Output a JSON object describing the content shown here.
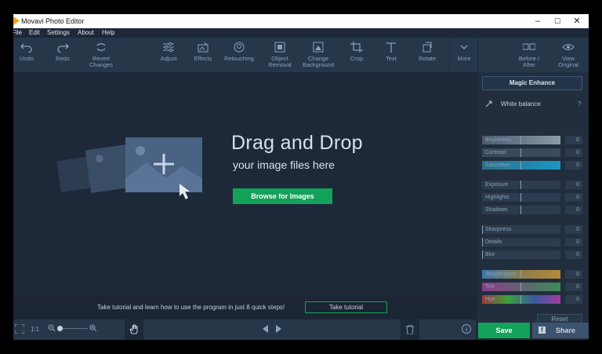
{
  "window": {
    "title": "Movavi Photo Editor",
    "minimize": "–",
    "maximize": "☐",
    "close": "✕"
  },
  "menu": [
    "File",
    "Edit",
    "Settings",
    "About",
    "Help"
  ],
  "toolbar": {
    "undo": "Undo",
    "redo": "Redo",
    "revert": [
      "Revert",
      "Changes"
    ],
    "adjust": "Adjust",
    "effects": "Effects",
    "retouching": "Retouching",
    "object_removal": [
      "Object",
      "Removal"
    ],
    "change_background": [
      "Change",
      "Background"
    ],
    "crop": "Crop",
    "text": "Text",
    "rotate": "Rotate",
    "more": "More",
    "before_after": [
      "Before /",
      "After"
    ],
    "view_original": [
      "View",
      "Original"
    ]
  },
  "canvas": {
    "drop_title": "Drag and Drop",
    "drop_subtitle": "your image files here",
    "browse_button": "Browse for Images"
  },
  "tutorial": {
    "text": "Take tutorial and learn how to use the program in just 8 quick steps!",
    "button": "Take tutorial"
  },
  "statusbar": {
    "zoom_ratio": "1:1"
  },
  "panel": {
    "magic_enhance": "Magic Enhance",
    "white_balance": "White balance",
    "help": "?",
    "sliders": [
      {
        "label": "Brightness",
        "value": "0",
        "fill": 1.0
      },
      {
        "label": "Contrast",
        "value": "0",
        "fill": 0.5
      },
      {
        "label": "Saturation",
        "value": "0",
        "fill": 1.0
      },
      {
        "label": "Exposure",
        "value": "0",
        "fill": 0.5
      },
      {
        "label": "Highlights",
        "value": "0",
        "fill": 0.5
      },
      {
        "label": "Shadows",
        "value": "0",
        "fill": 0.5
      },
      {
        "label": "Sharpness",
        "value": "0",
        "fill": 0.0
      },
      {
        "label": "Details",
        "value": "0",
        "fill": 0.0
      },
      {
        "label": "Blur",
        "value": "0",
        "fill": 0.0
      },
      {
        "label": "Temperature",
        "value": "0",
        "fill": 0.5
      },
      {
        "label": "Tint",
        "value": "0",
        "fill": 0.5
      },
      {
        "label": "Hue",
        "value": "0",
        "fill": 0.5
      }
    ],
    "reset": "Reset"
  },
  "save": "Save",
  "share": "Share",
  "colors": {
    "accent_green": "#14a15a",
    "bg": "#1d2938",
    "toolbar": "#26374a",
    "panel": "#222e3d"
  }
}
